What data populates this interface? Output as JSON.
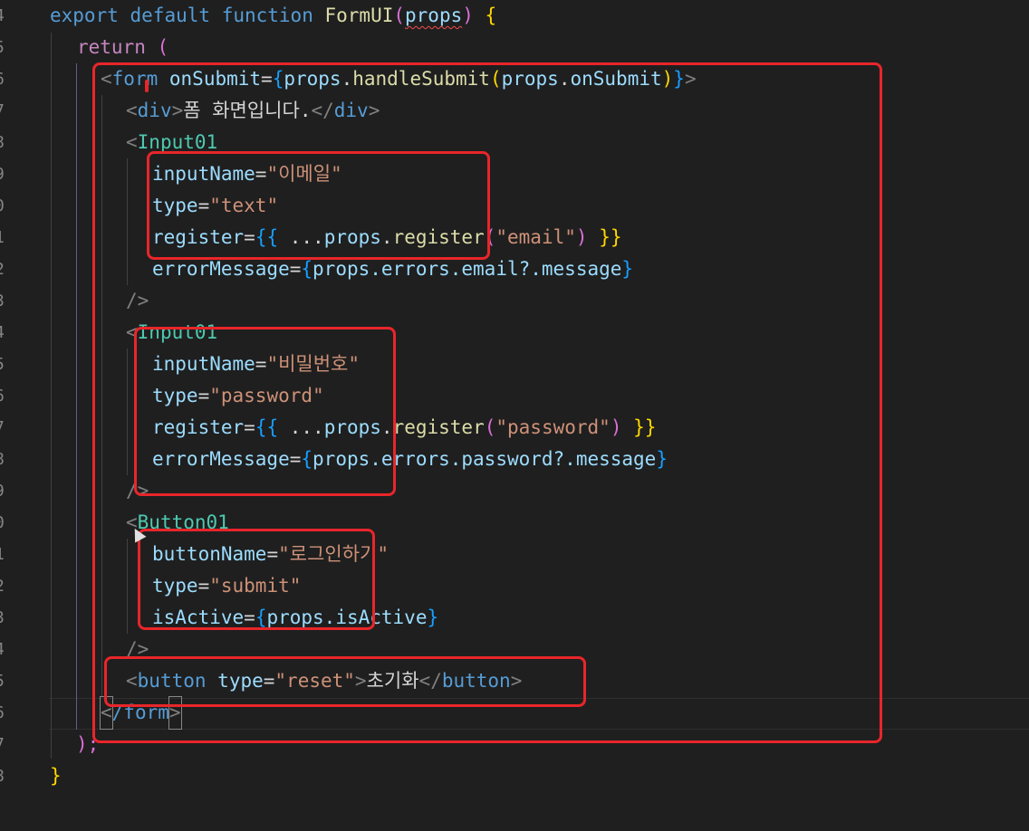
{
  "line_numbers": [
    "4",
    "5",
    "6",
    "7",
    "8",
    "9",
    "0",
    "1",
    "2",
    "3",
    "4",
    "5",
    "6",
    "7",
    "8",
    "9",
    "0",
    "1",
    "2",
    "3",
    "4",
    "5",
    "6",
    "7",
    "8"
  ],
  "code": {
    "l1": {
      "export": "export",
      "default": "default",
      "function": "function",
      "name": "FormUI",
      "open_paren": "(",
      "param": "props",
      "close_paren": ")",
      "brace": "{"
    },
    "l2": {
      "return": "return",
      "paren": "("
    },
    "l3": {
      "lt": "<",
      "tag": "form",
      "attr": "onSubmit",
      "eq": "=",
      "ob": "{",
      "obj": "props",
      "dot1": ".",
      "method": "handleSubmit",
      "p1": "(",
      "arg_obj": "props",
      "dot2": ".",
      "arg": "onSubmit",
      "p2": ")",
      "cb": "}",
      "gt": ">"
    },
    "l4": {
      "lt": "<",
      "tag": "div",
      "gt": ">",
      "text": "폼 화면입니다.",
      "close_lt": "</",
      "close_tag": "div",
      "close_gt": ">"
    },
    "l5": {
      "lt": "<",
      "comp": "Input01"
    },
    "l6": {
      "attr": "inputName",
      "eq": "=",
      "val": "\"이메일\""
    },
    "l7": {
      "attr": "type",
      "eq": "=",
      "val": "\"text\""
    },
    "l8": {
      "attr": "register",
      "eq": "=",
      "ob": "{{",
      "spread": " ...",
      "obj": "props",
      "dot": ".",
      "method": "register",
      "p1": "(",
      "arg": "\"email\"",
      "p2": ")",
      "cb": " }}"
    },
    "l9": {
      "attr": "errorMessage",
      "eq": "=",
      "ob": "{",
      "path": "props.errors.email?.message",
      "cb": "}"
    },
    "l10": {
      "close": "/>"
    },
    "l11": {
      "lt": "<",
      "comp": "Input01"
    },
    "l12": {
      "attr": "inputName",
      "eq": "=",
      "val": "\"비밀번호\""
    },
    "l13": {
      "attr": "type",
      "eq": "=",
      "val": "\"password\""
    },
    "l14": {
      "attr": "register",
      "eq": "=",
      "ob": "{{",
      "spread": " ...",
      "obj": "props",
      "dot": ".",
      "method": "register",
      "p1": "(",
      "arg": "\"password\"",
      "p2": ")",
      "cb": " }}"
    },
    "l15": {
      "attr": "errorMessage",
      "eq": "=",
      "ob": "{",
      "path": "props.errors.password?.message",
      "cb": "}"
    },
    "l16": {
      "close": "/>"
    },
    "l17": {
      "lt": "<",
      "comp": "Button01"
    },
    "l18": {
      "attr": "buttonName",
      "eq": "=",
      "val": "\"로그인하기\""
    },
    "l19": {
      "attr": "type",
      "eq": "=",
      "val": "\"submit\""
    },
    "l20": {
      "attr": "isActive",
      "eq": "=",
      "ob": "{",
      "path": "props.isActive",
      "cb": "}"
    },
    "l21": {
      "close": "/>"
    },
    "l22": {
      "lt": "<",
      "tag": "button",
      "attr": "type",
      "eq": "=",
      "val": "\"reset\"",
      "gt": ">",
      "text": "초기화",
      "close_lt": "</",
      "close_tag": "button",
      "close_gt": ">"
    },
    "l23": {
      "lt": "<",
      "close": "/form",
      "gt": ">"
    },
    "l24": {
      "close": ");"
    },
    "l25": {
      "close": "}"
    }
  },
  "colors": {
    "background": "#1f1f1f",
    "annotation_red": "#e8262a",
    "keyword_blue": "#569cd6",
    "control_purple": "#c586c0",
    "function_yellow": "#dcdcaa",
    "variable_lightblue": "#9cdcfe",
    "string_orange": "#ce9178",
    "component_teal": "#4ec9b0"
  },
  "icons": {
    "cursor": "mouse-pointer-icon"
  }
}
